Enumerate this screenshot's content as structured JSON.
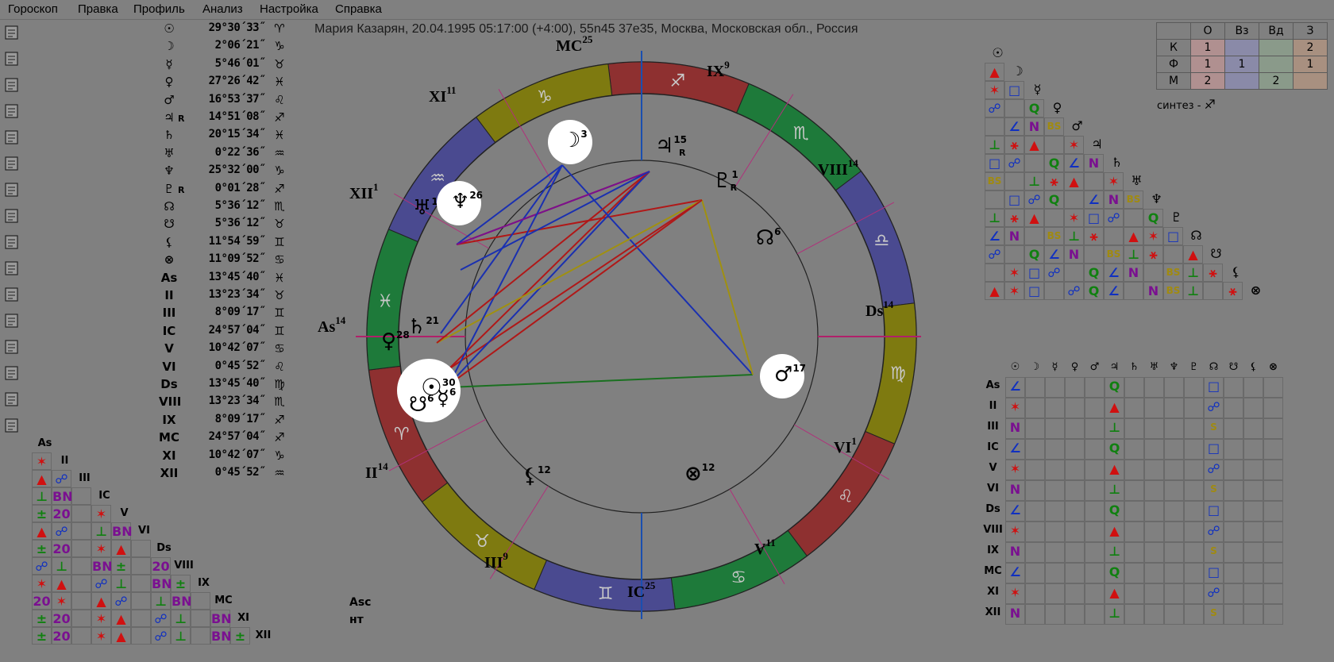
{
  "menu": [
    "Гороскоп",
    "Правка",
    "Профиль",
    "Анализ",
    "Настройка",
    "Справка"
  ],
  "toolbar_icons": [
    "open-horoscope-icon",
    "new-document-icon",
    "page-icon",
    "checklist-icon",
    "clock-icon",
    "people-icon",
    "list-icon",
    "windows-icon",
    "chart-bars-icon",
    "folder-icon",
    "image-icon",
    "export-icon",
    "zoom-waves-icon",
    "zoom-icon",
    "briefcase-icon",
    "plus-icon"
  ],
  "chart_title": "Мария Казарян, 20.04.1995 05:17:00 (+4:00), 55n45 37e35, Москва, Московская обл., Россия",
  "planets": [
    {
      "glyph": "☉",
      "r": "",
      "deg": "29°30´33˝",
      "sign": "♈"
    },
    {
      "glyph": "☽",
      "r": "",
      "deg": "2°06´21˝",
      "sign": "♑"
    },
    {
      "glyph": "☿",
      "r": "",
      "deg": "5°46´01˝",
      "sign": "♉"
    },
    {
      "glyph": "♀",
      "r": "",
      "deg": "27°26´42˝",
      "sign": "♓"
    },
    {
      "glyph": "♂",
      "r": "",
      "deg": "16°53´37˝",
      "sign": "♌"
    },
    {
      "glyph": "♃",
      "r": "R",
      "deg": "14°51´08˝",
      "sign": "♐"
    },
    {
      "glyph": "♄",
      "r": "",
      "deg": "20°15´34˝",
      "sign": "♓"
    },
    {
      "glyph": "♅",
      "r": "",
      "deg": "0°22´36˝",
      "sign": "♒"
    },
    {
      "glyph": "♆",
      "r": "",
      "deg": "25°32´00˝",
      "sign": "♑"
    },
    {
      "glyph": "♇",
      "r": "R",
      "deg": "0°01´28˝",
      "sign": "♐"
    },
    {
      "glyph": "☊",
      "r": "",
      "deg": "5°36´12˝",
      "sign": "♏"
    },
    {
      "glyph": "☋",
      "r": "",
      "deg": "5°36´12˝",
      "sign": "♉"
    },
    {
      "glyph": "⚸",
      "r": "",
      "deg": "11°54´59˝",
      "sign": "♊"
    },
    {
      "glyph": "⊗",
      "r": "",
      "deg": "11°09´52˝",
      "sign": "♋"
    },
    {
      "glyph": "As",
      "r": "",
      "deg": "13°45´40˝",
      "sign": "♓"
    },
    {
      "glyph": "II",
      "r": "",
      "deg": "13°23´34˝",
      "sign": "♉"
    },
    {
      "glyph": "III",
      "r": "",
      "deg": "8°09´17˝",
      "sign": "♊"
    },
    {
      "glyph": "IC",
      "r": "",
      "deg": "24°57´04˝",
      "sign": "♊"
    },
    {
      "glyph": "V",
      "r": "",
      "deg": "10°42´07˝",
      "sign": "♋"
    },
    {
      "glyph": "VI",
      "r": "",
      "deg": "0°45´52˝",
      "sign": "♌"
    },
    {
      "glyph": "Ds",
      "r": "",
      "deg": "13°45´40˝",
      "sign": "♍"
    },
    {
      "glyph": "VIII",
      "r": "",
      "deg": "13°23´34˝",
      "sign": "♏"
    },
    {
      "glyph": "IX",
      "r": "",
      "deg": "8°09´17˝",
      "sign": "♐"
    },
    {
      "glyph": "MC",
      "r": "",
      "deg": "24°57´04˝",
      "sign": "♐"
    },
    {
      "glyph": "XI",
      "r": "",
      "deg": "10°42´07˝",
      "sign": "♑"
    },
    {
      "glyph": "XII",
      "r": "",
      "deg": "0°45´52˝",
      "sign": "♒"
    }
  ],
  "wheel": {
    "house_labels": [
      {
        "t": "MC",
        "n": "25"
      },
      {
        "t": "IX",
        "n": "9"
      },
      {
        "t": "VIII",
        "n": "14"
      },
      {
        "t": "Ds",
        "n": "14"
      },
      {
        "t": "VI",
        "n": "1"
      },
      {
        "t": "V",
        "n": "11"
      },
      {
        "t": "IC",
        "n": "25"
      },
      {
        "t": "III",
        "n": "9"
      },
      {
        "t": "II",
        "n": "14"
      },
      {
        "t": "As",
        "n": "14"
      },
      {
        "t": "XII",
        "n": "1"
      },
      {
        "t": "XI",
        "n": "11"
      }
    ],
    "planet_labels": [
      {
        "g": "☽",
        "n": "3",
        "r": ""
      },
      {
        "g": "♃",
        "n": "15",
        "r": "R"
      },
      {
        "g": "♇",
        "n": "1",
        "r": "R"
      },
      {
        "g": "☊",
        "n": "6",
        "r": ""
      },
      {
        "g": "♂",
        "n": "17",
        "r": ""
      },
      {
        "g": "⊗",
        "n": "12",
        "r": ""
      },
      {
        "g": "⚸",
        "n": "12",
        "r": ""
      },
      {
        "g": "☉",
        "n": "30",
        "r": ""
      },
      {
        "g": "☿",
        "n": "6",
        "r": ""
      },
      {
        "g": "☋",
        "n": "6",
        "r": ""
      },
      {
        "g": "♀",
        "n": "28",
        "r": ""
      },
      {
        "g": "♄",
        "n": "21",
        "r": ""
      },
      {
        "g": "♅",
        "n": "1",
        "r": ""
      },
      {
        "g": "♆",
        "n": "26",
        "r": ""
      }
    ],
    "zodiac_glyphs": [
      "♐",
      "♏",
      "♎",
      "♍",
      "♌",
      "♋",
      "♊",
      "♉",
      "♈",
      "♓",
      "♒",
      "♑"
    ]
  },
  "qualities": {
    "headers": [
      "",
      "О",
      "Вз",
      "Вд",
      "З"
    ],
    "rows": [
      {
        "label": "К",
        "vals": [
          "1",
          "",
          "",
          "2"
        ]
      },
      {
        "label": "Ф",
        "vals": [
          "1",
          "1",
          "",
          "1"
        ]
      },
      {
        "label": "М",
        "vals": [
          "2",
          "",
          "2",
          ""
        ]
      }
    ],
    "synth_label": "синтез - ",
    "synth_glyph": "♐"
  },
  "planet_grid_labels": [
    "☉",
    "☽",
    "☿",
    "♀",
    "♂",
    "♃",
    "♄",
    "♅",
    "♆",
    "♇",
    "☊",
    "☋",
    "⚸",
    "⊗"
  ],
  "house_grid_cols": [
    "☉",
    "☽",
    "☿",
    "♀",
    "♂",
    "♃",
    "♄",
    "♅",
    "♆",
    "♇",
    "☊",
    "☋",
    "⚸",
    "⊗"
  ],
  "house_grid_rows": [
    "As",
    "II",
    "III",
    "IC",
    "V",
    "VI",
    "Ds",
    "VIII",
    "IX",
    "MC",
    "XI",
    "XII"
  ],
  "house_tri_labels": [
    "As",
    "II",
    "III",
    "IC",
    "V",
    "VI",
    "Ds",
    "VIII",
    "IX",
    "MC",
    "XI",
    "XII"
  ],
  "asc_note": [
    "Asc",
    "нт"
  ],
  "colors": {
    "red": "#d01010",
    "blue": "#1030c0",
    "green": "#108010",
    "purple": "#7a1090",
    "olive": "#a08a10"
  }
}
